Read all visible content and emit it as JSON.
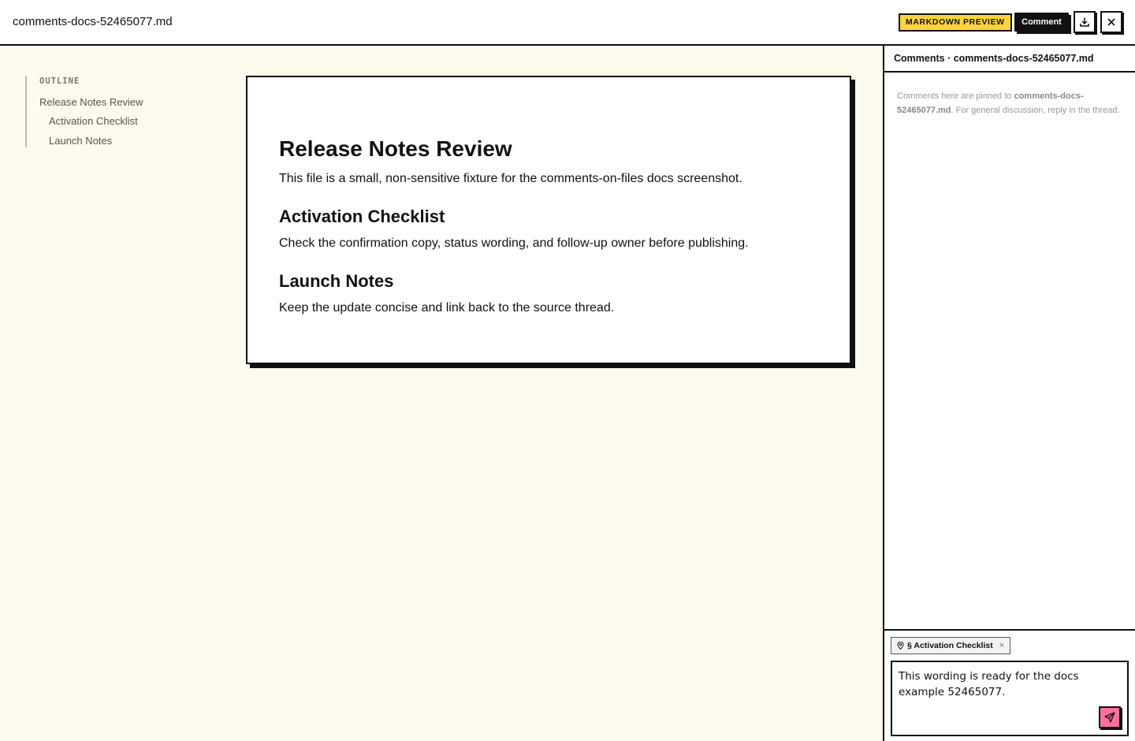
{
  "topbar": {
    "file_name": "comments-docs-52465077.md",
    "mode_badge": "MARKDOWN PREVIEW",
    "comment_label": "Comment",
    "download_icon": "download-icon",
    "close_icon": "close-icon"
  },
  "outline": {
    "label": "OUTLINE",
    "items": [
      {
        "label": "Release Notes Review",
        "level": 1
      },
      {
        "label": "Activation Checklist",
        "level": 2
      },
      {
        "label": "Launch Notes",
        "level": 2
      }
    ]
  },
  "document": {
    "title": "Release Notes Review",
    "intro": "This file is a small, non-sensitive fixture for the comments-on-files docs screenshot.",
    "sections": [
      {
        "heading": "Activation Checklist",
        "body": "Check the confirmation copy, status wording, and follow-up owner before publishing."
      },
      {
        "heading": "Launch Notes",
        "body": "Keep the update concise and link back to the source thread."
      }
    ]
  },
  "panel": {
    "header": "Comments · comments-docs-52465077.md",
    "note_prefix": "Comments here are pinned to ",
    "note_file": "comments-docs-52465077.md",
    "note_suffix": ". For general discussion, reply in the thread.",
    "anchor_chip": "§ Activation Checklist",
    "chip_remove": "×",
    "draft": "This wording is ready for the docs example 52465077.",
    "send_icon": "send-icon",
    "colors": {
      "accent_yellow": "#ffd43b",
      "send_pink": "#ff6f9f",
      "canvas": "#fffaee"
    }
  }
}
